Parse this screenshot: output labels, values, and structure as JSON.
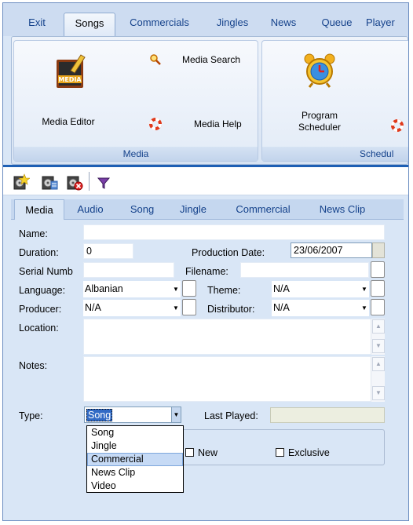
{
  "ribbon": {
    "tabs": [
      "Exit",
      "Songs",
      "Commercials",
      "Jingles",
      "News",
      "Queue",
      "Player"
    ],
    "active_tab": "Songs",
    "media_group": {
      "label": "Media",
      "media_editor": "Media Editor",
      "media_icon_text": "MEDIA",
      "media_search": "Media Search",
      "media_help": "Media Help"
    },
    "scheduler_group": {
      "label": "Schedul",
      "program_scheduler_line1": "Program",
      "program_scheduler_line2": "Scheduler"
    }
  },
  "toolbar": {
    "icons": [
      "add-media-icon",
      "edit-media-icon",
      "delete-media-icon",
      "filter-icon"
    ]
  },
  "form_tabs": [
    "Media",
    "Audio",
    "Song",
    "Jingle",
    "Commercial",
    "News Clip"
  ],
  "active_form_tab": "Media",
  "form": {
    "name_label": "Name:",
    "name_value": "",
    "duration_label": "Duration:",
    "duration_value": "0",
    "production_date_label": "Production Date:",
    "production_date_value": "23/06/2007",
    "serial_label": "Serial Numb",
    "serial_value": "",
    "filename_label": "Filename:",
    "filename_value": "",
    "language_label": "Language:",
    "language_value": "Albanian",
    "theme_label": "Theme:",
    "theme_value": "N/A",
    "producer_label": "Producer:",
    "producer_value": "N/A",
    "distributor_label": "Distributor:",
    "distributor_value": "N/A",
    "location_label": "Location:",
    "notes_label": "Notes:",
    "type_label": "Type:",
    "type_value": "Song",
    "last_played_label": "Last Played:",
    "last_played_value": "",
    "new_label": "New",
    "exclusive_label": "Exclusive"
  },
  "type_dropdown": {
    "options": [
      "Song",
      "Jingle",
      "Commercial",
      "News Clip",
      "Video"
    ],
    "highlighted": "Commercial"
  }
}
